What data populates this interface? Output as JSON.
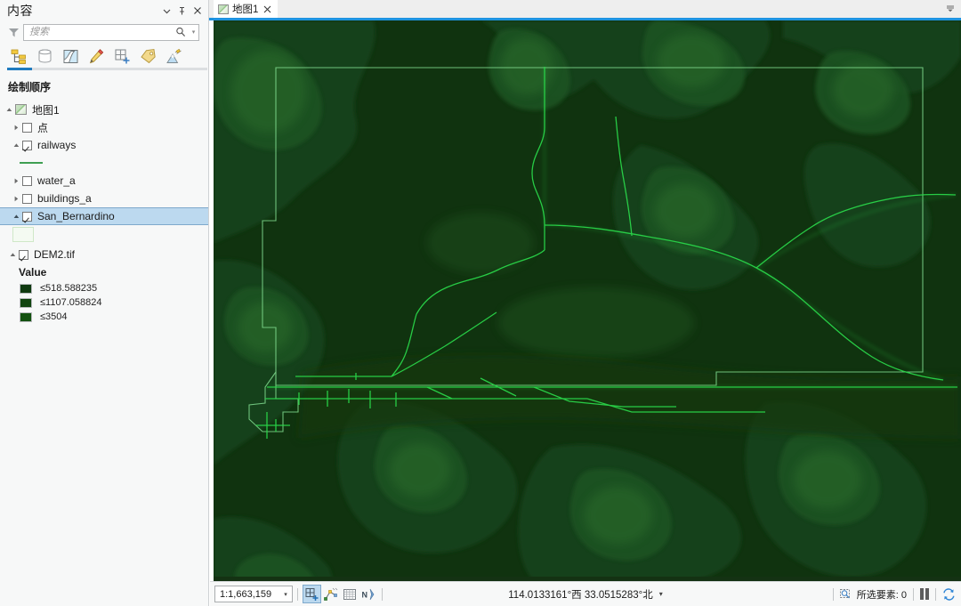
{
  "contents_pane": {
    "title": "内容",
    "header_buttons": [
      {
        "name": "pane-menu-button",
        "glyph": "▾"
      },
      {
        "name": "pane-pin-button",
        "glyph": "pin-icon"
      },
      {
        "name": "pane-close-button",
        "glyph": "✕"
      }
    ],
    "search": {
      "placeholder": "搜索",
      "value": "",
      "filter_icon": "filter-icon",
      "search_icon": "search-icon",
      "dropdown_icon": "chevron-down-icon"
    },
    "toolbar": [
      {
        "name": "list-by-draw-order-button",
        "icon": "draw-order-icon",
        "active": true
      },
      {
        "name": "list-by-data-source-button",
        "icon": "database-icon",
        "active": false
      },
      {
        "name": "list-by-selection-button",
        "icon": "selection-icon",
        "active": false
      },
      {
        "name": "list-by-editing-button",
        "icon": "pencil-icon",
        "active": false
      },
      {
        "name": "list-by-snapping-button",
        "icon": "add-grid-icon",
        "active": false
      },
      {
        "name": "list-by-labeling-button",
        "icon": "label-tag-icon",
        "active": false
      },
      {
        "name": "list-by-elevation-button",
        "icon": "elevation-icon",
        "active": false
      }
    ],
    "section_title": "绘制顺序",
    "tree": {
      "map_node": {
        "label": "地图1",
        "expander": "▴",
        "thumb": "map-thumbnail-icon"
      },
      "layers": [
        {
          "name": "dian",
          "label": "点",
          "checked": false,
          "expander": "▸",
          "symbol": null
        },
        {
          "name": "railways",
          "label": "railways",
          "checked": true,
          "expander": "▴",
          "symbol": "line"
        },
        {
          "name": "water_a",
          "label": "water_a",
          "checked": false,
          "expander": "▸",
          "symbol": null
        },
        {
          "name": "buildings_a",
          "label": "buildings_a",
          "checked": false,
          "expander": "▸",
          "symbol": null
        },
        {
          "name": "san_bernardino",
          "label": "San_Bernardino",
          "checked": true,
          "expander": "▴",
          "symbol": "polygon",
          "selected": true
        }
      ],
      "raster_layer": {
        "label": "DEM2.tif",
        "checked": true,
        "expander": "▴",
        "value_header": "Value",
        "classes": [
          {
            "label": "≤518.588235",
            "color": "#0f3a10"
          },
          {
            "label": "≤1107.058824",
            "color": "#10440f"
          },
          {
            "label": "≤3504",
            "color": "#12510f"
          }
        ]
      }
    }
  },
  "tabbar": {
    "tabs": [
      {
        "label": "地图1",
        "active": true,
        "thumb": "map-thumbnail-icon",
        "close": "✕"
      }
    ],
    "overflow_icon": "chevron-down-icon",
    "accent_color": "#1f93e0"
  },
  "statusbar": {
    "scale": "1:1,663,159",
    "scale_dropdown_icon": "chevron-down-icon",
    "tools": [
      {
        "name": "add-data-button",
        "icon": "add-grid-icon",
        "active": true
      },
      {
        "name": "snapping-button",
        "icon": "snapping-icon",
        "active": false
      },
      {
        "name": "grid-button",
        "icon": "grid-icon",
        "active": false
      },
      {
        "name": "north-arrow-button",
        "icon": "north-arrow-icon",
        "active": false
      }
    ],
    "coordinates": "114.0133161°西 33.0515283°北",
    "coord_dropdown_icon": "chevron-down-icon",
    "selection_icon": "select-features-icon",
    "selected_features": "所选要素: 0",
    "pause_icon": "pause-drawing-icon",
    "refresh_icon": "refresh-icon"
  },
  "map": {
    "background_color": "#143213",
    "dem_colors": [
      "#0f3210",
      "#17431a",
      "#1d5220",
      "#2a6b2b"
    ],
    "railway_color": "#2ad94a",
    "boundary_color": "#7fd98d"
  }
}
